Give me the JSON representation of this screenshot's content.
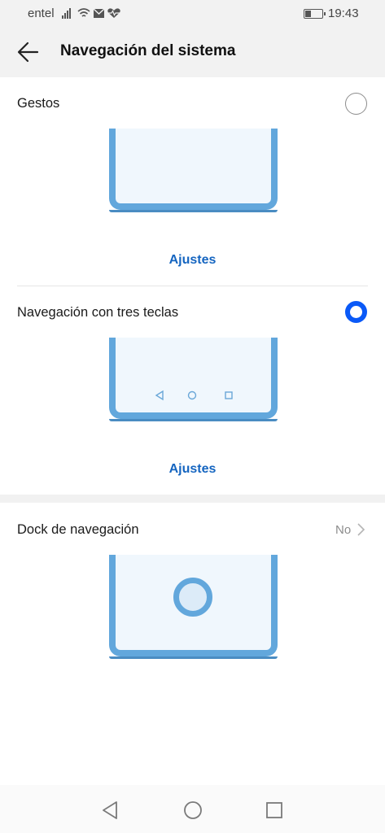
{
  "status_bar": {
    "carrier": "entel",
    "time": "19:43",
    "battery_level": 0.3
  },
  "header": {
    "title": "Navegación del sistema",
    "back_icon": "arrow-left-icon"
  },
  "options": [
    {
      "label": "Gestos",
      "selected": false,
      "settings_label": "Ajustes"
    },
    {
      "label": "Navegación con tres teclas",
      "selected": true,
      "settings_label": "Ajustes"
    }
  ],
  "dock": {
    "label": "Dock de navegación",
    "value": "No",
    "chevron_icon": "chevron-right-icon"
  },
  "nav_bar": {
    "icons": [
      "back-triangle-icon",
      "home-circle-icon",
      "recents-square-icon"
    ]
  },
  "colors": {
    "accent": "#0a59f7",
    "link": "#1565c0",
    "illustration": "#62a7dc"
  }
}
